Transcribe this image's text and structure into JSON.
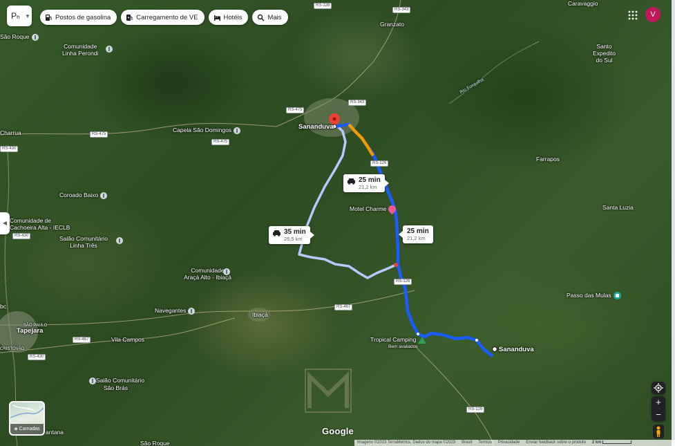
{
  "search": {
    "text": "Pₕ"
  },
  "chips": [
    {
      "label": "Postos de gasolina",
      "icon": "gas-station-icon"
    },
    {
      "label": "Carregamento de VE",
      "icon": "ev-charging-icon"
    },
    {
      "label": "Hotéis",
      "icon": "hotel-icon"
    },
    {
      "label": "Mais",
      "icon": "search-icon"
    }
  ],
  "account": {
    "initial": "V",
    "color": "#c2185b"
  },
  "places": {
    "sananduva_origin": "Sananduva",
    "sananduva_dest": "Sananduva",
    "granzato": "Granzato",
    "santo_expedito": "Santo\nExpedito\ndo Sul",
    "sao_roque_top": "São Roque",
    "com_perondi": "Comunidade\nLinha Perondi",
    "capela": "Capela São Domingos",
    "charrua": "Charrua",
    "farrapos": "Farrapos",
    "santa_luzia": "Santa Luzia",
    "coroado": "Coroado Baixo",
    "motel": "Motel Charme",
    "cachoeira": "Comunidade de\nCachoeira Alta - IECLB",
    "salao_tres": "Salão Comunitário\nLinha Três",
    "araca": "Comunidade\nAraçá Alto - Ibiaçá",
    "navegantes": "Navegantes",
    "ibiaca": "Ibiaçá",
    "passo_mulas": "Passo das Mulas",
    "tropical": "Tropical Camping",
    "tropical_sub": "Bem avaliados",
    "vila_campos": "Vila Campos",
    "tapejara": "Tapejara",
    "sao_paulo": "SÃO PAULO",
    "cristovao": "CRISTÓVÃO",
    "salao_bras": "Salão Comunitário\nSão Brás",
    "sao_roque_bottom": "São Roque",
    "caravaggio": "Caravaggio",
    "antana": "antana",
    "bc": "bc"
  },
  "roads": [
    "RS-126",
    "RS-343",
    "RS-343",
    "RS-475",
    "RS-475",
    "RS-475",
    "RS-126",
    "RS-126",
    "RS-126",
    "RS-467",
    "RS-467",
    "RS-430",
    "RS-430",
    "RS-430",
    "RS-126"
  ],
  "river": "Rio Forquilha",
  "routes": [
    {
      "time": "25 min",
      "distance": "21,2 km",
      "type": "car"
    },
    {
      "time": "35 min",
      "distance": "26,5 km",
      "type": "car"
    },
    {
      "time": "25 min",
      "distance": "21,2 km",
      "type": "car"
    }
  ],
  "layers": {
    "label": "Camadas"
  },
  "google": "Google",
  "footer": {
    "attribution": "Imagens ©2023 TerraMetrics, Dados do mapa ©2023",
    "country": "Brasil",
    "terms": "Termos",
    "privacy": "Privacidade",
    "feedback": "Enviar feedback sobre o produto",
    "scale": "2 km"
  },
  "colors": {
    "route_main": "#1a5cff",
    "route_alt": "#b8c9ff",
    "traffic": "#f29900",
    "pin": "#ea4335"
  }
}
